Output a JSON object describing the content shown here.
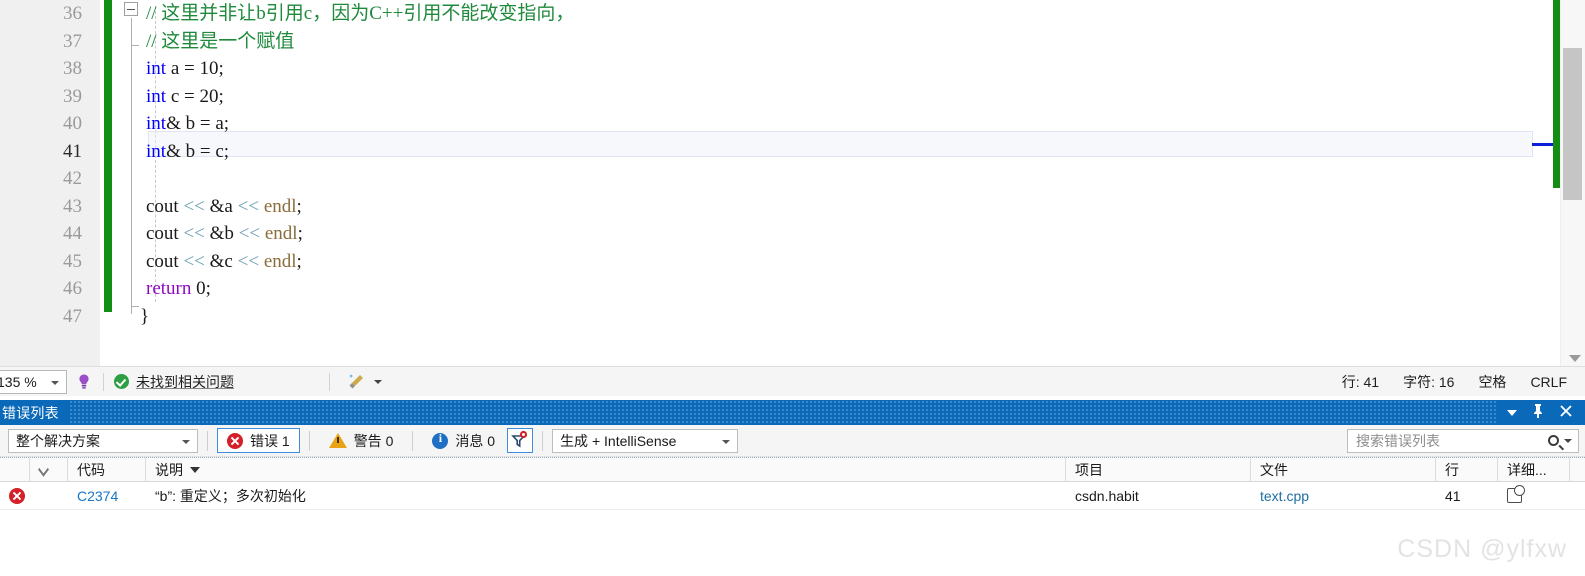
{
  "editor": {
    "lines": [
      {
        "num": "36",
        "tokens": [
          {
            "t": "// 这里并非让b引用c，因为C++引用不能改变指向，",
            "c": "cmt"
          }
        ]
      },
      {
        "num": "37",
        "tokens": [
          {
            "t": "// 这里是一个赋值",
            "c": "cmt"
          }
        ]
      },
      {
        "num": "38",
        "tokens": [
          {
            "t": "int",
            "c": "kw"
          },
          {
            "t": " a ",
            "c": "id"
          },
          {
            "t": "=",
            "c": "id"
          },
          {
            "t": " 10;",
            "c": "id"
          }
        ]
      },
      {
        "num": "39",
        "tokens": [
          {
            "t": "int",
            "c": "kw"
          },
          {
            "t": " c ",
            "c": "id"
          },
          {
            "t": "=",
            "c": "id"
          },
          {
            "t": " 20;",
            "c": "id"
          }
        ]
      },
      {
        "num": "40",
        "tokens": [
          {
            "t": "int",
            "c": "kw"
          },
          {
            "t": "& b ",
            "c": "id"
          },
          {
            "t": "=",
            "c": "id"
          },
          {
            "t": " a;",
            "c": "id"
          }
        ]
      },
      {
        "num": "41",
        "tokens": [
          {
            "t": "int",
            "c": "kw"
          },
          {
            "t": "& b ",
            "c": "id"
          },
          {
            "t": "=",
            "c": "id"
          },
          {
            "t": " c;",
            "c": "id"
          }
        ],
        "current": true
      },
      {
        "num": "42",
        "tokens": []
      },
      {
        "num": "43",
        "tokens": [
          {
            "t": "cout ",
            "c": "id"
          },
          {
            "t": "<<",
            "c": "op"
          },
          {
            "t": " &a ",
            "c": "id"
          },
          {
            "t": "<<",
            "c": "op"
          },
          {
            "t": " ",
            "c": "id"
          },
          {
            "t": "endl",
            "c": "fn"
          },
          {
            "t": ";",
            "c": "id"
          }
        ]
      },
      {
        "num": "44",
        "tokens": [
          {
            "t": "cout ",
            "c": "id"
          },
          {
            "t": "<<",
            "c": "op"
          },
          {
            "t": " &b ",
            "c": "id"
          },
          {
            "t": "<<",
            "c": "op"
          },
          {
            "t": " ",
            "c": "id"
          },
          {
            "t": "endl",
            "c": "fn"
          },
          {
            "t": ";",
            "c": "id"
          }
        ]
      },
      {
        "num": "45",
        "tokens": [
          {
            "t": "cout ",
            "c": "id"
          },
          {
            "t": "<<",
            "c": "op"
          },
          {
            "t": " &c ",
            "c": "id"
          },
          {
            "t": "<<",
            "c": "op"
          },
          {
            "t": " ",
            "c": "id"
          },
          {
            "t": "endl",
            "c": "fn"
          },
          {
            "t": ";",
            "c": "id"
          }
        ]
      },
      {
        "num": "46",
        "tokens": [
          {
            "t": "return",
            "c": "kw2"
          },
          {
            "t": " 0;",
            "c": "id"
          }
        ]
      },
      {
        "num": "47",
        "tokens": [
          {
            "t": "}",
            "c": "id"
          }
        ],
        "noindent": true
      }
    ]
  },
  "statusbar": {
    "zoom": "135 %",
    "analyze_icon": "code-analysis-icon",
    "issues_text": "未找到相关问题",
    "broom_icon": "cleanup-broom-icon",
    "line_label": "行: 41",
    "char_label": "字符: 16",
    "spaces_label": "空格",
    "eol_label": "CRLF"
  },
  "error_list": {
    "title": "错误列表",
    "toolbar": {
      "scope_value": "整个解决方案",
      "errors_label": "错误 1",
      "warnings_label": "警告 0",
      "messages_label": "消息 0",
      "filter_icon": "filter-funnel-icon",
      "build_value": "生成 + IntelliSense",
      "search_placeholder": "搜索错误列表"
    },
    "columns": [
      {
        "key": "icon",
        "label": ""
      },
      {
        "key": "sel",
        "label": ""
      },
      {
        "key": "code",
        "label": "代码"
      },
      {
        "key": "desc",
        "label": "说明"
      },
      {
        "key": "proj",
        "label": "项目"
      },
      {
        "key": "file",
        "label": "文件"
      },
      {
        "key": "line",
        "label": "行"
      },
      {
        "key": "det",
        "label": "详细..."
      }
    ],
    "rows": [
      {
        "severity": "error",
        "code": "C2374",
        "description": "“b”: 重定义；多次初始化",
        "project": "csdn.habit",
        "file": "text.cpp",
        "line": "41",
        "details_icon": "copy-details-icon"
      }
    ]
  },
  "watermark": "CSDN @ylfxw",
  "colors": {
    "accent_blue": "#0a69b8",
    "error_red": "#d32029",
    "warn_amber": "#e8a317",
    "info_blue": "#1f6fc4",
    "changebar_green": "#138d13",
    "keyword_blue": "#0000ff",
    "comment_green": "#1f8a3c"
  }
}
